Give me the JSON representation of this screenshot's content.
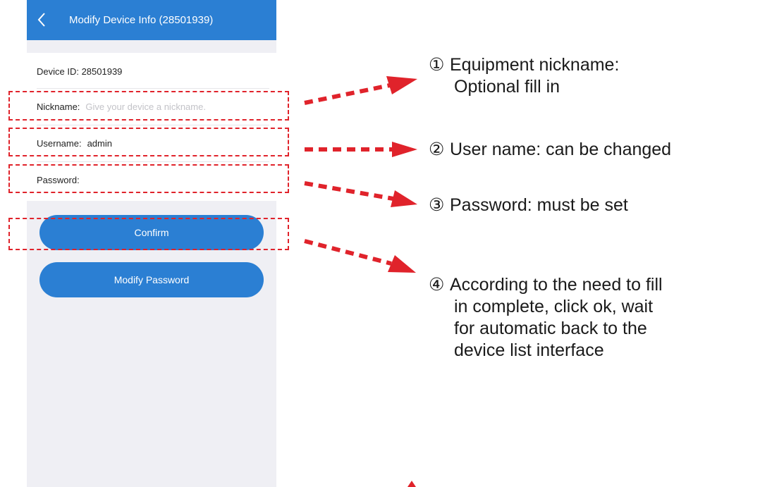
{
  "header": {
    "title": "Modify Device Info (28501939)"
  },
  "form": {
    "device_id_label": "Device ID: 28501939",
    "nickname_label": "Nickname:",
    "nickname_placeholder": "Give your device a nickname.",
    "username_label": "Username:",
    "username_value": "admin",
    "password_label": "Password:",
    "password_value": ""
  },
  "buttons": {
    "confirm": "Confirm",
    "modify_password": "Modify Password"
  },
  "annotations": [
    {
      "num": "①",
      "line1": "Equipment nickname:",
      "line2": "Optional fill in"
    },
    {
      "num": "②",
      "line1": "User name: can be changed"
    },
    {
      "num": "③",
      "line1": "Password: must be set"
    },
    {
      "num": "④",
      "line1": "According to the need to fill",
      "line2": "in complete, click ok, wait",
      "line3": "for automatic back to the",
      "line4": "device list interface"
    }
  ],
  "colors": {
    "accent": "#2b7fd3",
    "annotation": "#e0232b",
    "background": "#efeff4"
  }
}
